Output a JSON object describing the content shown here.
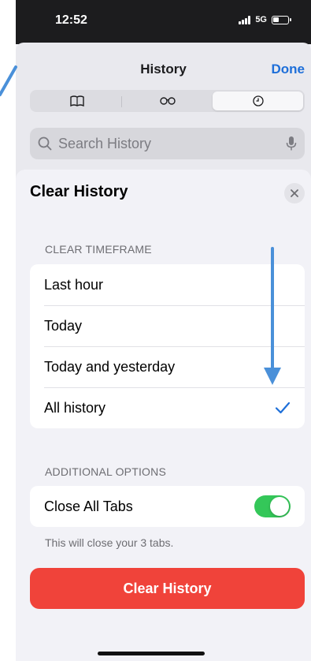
{
  "status_bar": {
    "time": "12:52",
    "network": "5G"
  },
  "history": {
    "title": "History",
    "done_label": "Done",
    "segments": [
      {
        "icon": "book-icon",
        "selected": false
      },
      {
        "icon": "reading-glasses-icon",
        "selected": false
      },
      {
        "icon": "clock-icon",
        "selected": true
      }
    ],
    "search_placeholder": "Search History"
  },
  "clear_history": {
    "title": "Clear History",
    "timeframe_header": "CLEAR TIMEFRAME",
    "timeframes": [
      {
        "label": "Last hour",
        "selected": false
      },
      {
        "label": "Today",
        "selected": false
      },
      {
        "label": "Today and yesterday",
        "selected": false
      },
      {
        "label": "All history",
        "selected": true
      }
    ],
    "options_header": "ADDITIONAL OPTIONS",
    "close_tabs_label": "Close All Tabs",
    "close_tabs_on": true,
    "close_tabs_note": "This will close your 3 tabs.",
    "clear_button_label": "Clear History"
  },
  "colors": {
    "accent_blue": "#1e6fd9",
    "destructive_red": "#f0433a",
    "toggle_green": "#34c759",
    "annotation_arrow": "#4a90d9"
  }
}
